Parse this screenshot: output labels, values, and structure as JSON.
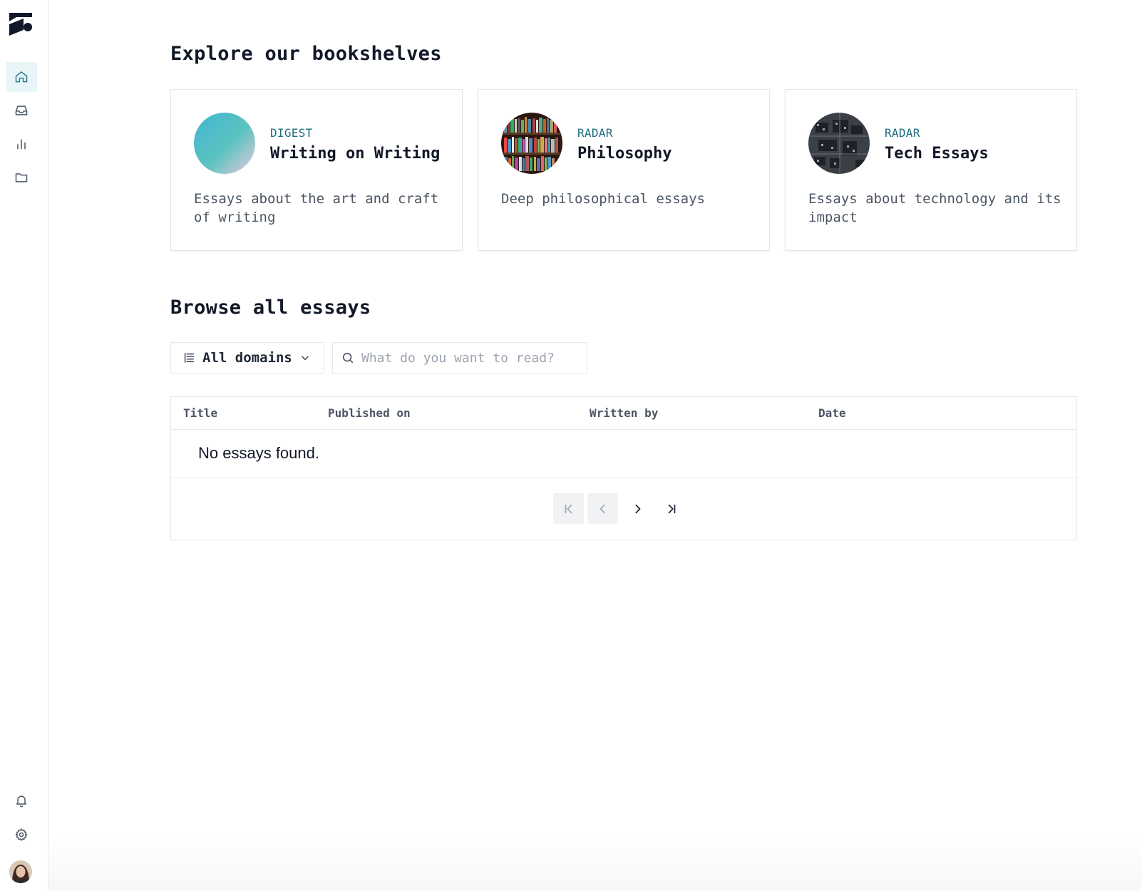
{
  "sidebar": {
    "logo": "brand-logo",
    "nav": [
      {
        "icon": "home-icon",
        "active": true
      },
      {
        "icon": "inbox-icon",
        "active": false
      },
      {
        "icon": "bar-chart-icon",
        "active": false
      },
      {
        "icon": "folder-icon",
        "active": false
      }
    ],
    "bottom": [
      {
        "icon": "bell-icon"
      },
      {
        "icon": "gear-icon"
      }
    ],
    "avatar": "user-avatar"
  },
  "bookshelves": {
    "title": "Explore our bookshelves",
    "cards": [
      {
        "tag": "DIGEST",
        "name": "Writing on Writing",
        "description": "Essays about the art and craft of writing"
      },
      {
        "tag": "RADAR",
        "name": "Philosophy",
        "description": "Deep philosophical essays"
      },
      {
        "tag": "RADAR",
        "name": "Tech Essays",
        "description": "Essays about technology and its impact"
      }
    ]
  },
  "browse": {
    "title": "Browse all essays",
    "domain_select": {
      "label": "All domains"
    },
    "search": {
      "placeholder": "What do you want to read?",
      "value": ""
    },
    "table": {
      "columns": [
        "Title",
        "Published on",
        "Written by",
        "Date"
      ],
      "empty_message": "No essays found."
    },
    "pagination": {
      "first_disabled": true,
      "prev_disabled": true
    }
  },
  "colors": {
    "accent": "#1d6b82",
    "active_nav_bg": "#e8f6f8",
    "border": "#e5e7eb"
  }
}
